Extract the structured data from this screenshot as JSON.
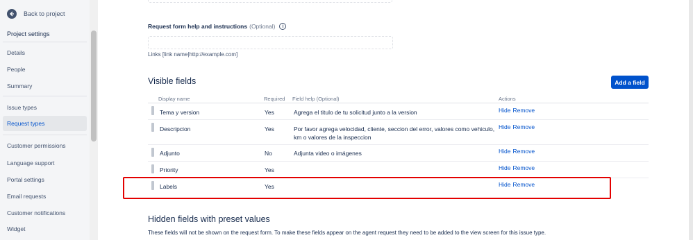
{
  "sidebar": {
    "back_label": "Back to project",
    "title": "Project settings",
    "items": [
      {
        "label": "Details"
      },
      {
        "label": "People"
      },
      {
        "label": "Summary"
      },
      {
        "label": "Issue types"
      },
      {
        "label": "Request types"
      },
      {
        "label": "Customer permissions"
      },
      {
        "label": "Language support"
      },
      {
        "label": "Portal settings"
      },
      {
        "label": "Email requests"
      },
      {
        "label": "Customer notifications"
      },
      {
        "label": "Widget"
      }
    ],
    "active_item": "Request types"
  },
  "help": {
    "label": "Request form help and instructions",
    "optional": "(Optional)",
    "info_icon": "info-icon",
    "hint": "Links [link name|http://example.com]"
  },
  "visible_fields": {
    "title": "Visible fields",
    "add_button": "Add a field",
    "headers": {
      "display_name": "Display name",
      "required": "Required",
      "field_help": "Field help (Optional)",
      "actions": "Actions"
    },
    "rows": [
      {
        "name": "Tema y version",
        "required": "Yes",
        "help": "Agrega el titulo de tu solicitud junto a la version",
        "hide": "Hide",
        "remove": "Remove"
      },
      {
        "name": "Descripcion",
        "required": "Yes",
        "help": "Por favor agrega velocidad, cliente, seccion del error, valores como vehiculo, km o valores de la inspeccion",
        "hide": "Hide",
        "remove": "Remove"
      },
      {
        "name": "Adjunto",
        "required": "No",
        "help": "Adjunta video o imágenes",
        "hide": "Hide",
        "remove": "Remove"
      },
      {
        "name": "Priority",
        "required": "Yes",
        "help": "",
        "hide": "Hide",
        "remove": "Remove"
      },
      {
        "name": "Labels",
        "required": "Yes",
        "help": "",
        "hide": "Hide",
        "remove": "Remove"
      }
    ]
  },
  "hidden_fields": {
    "title": "Hidden fields with preset values",
    "description": "These fields will not be shown on the request form. To make these fields appear on the agent request they need to be added to the view screen for this issue type."
  },
  "colors": {
    "accent": "#0052cc",
    "highlight": "#e30000",
    "sidebar_bg": "#f4f5f7"
  }
}
